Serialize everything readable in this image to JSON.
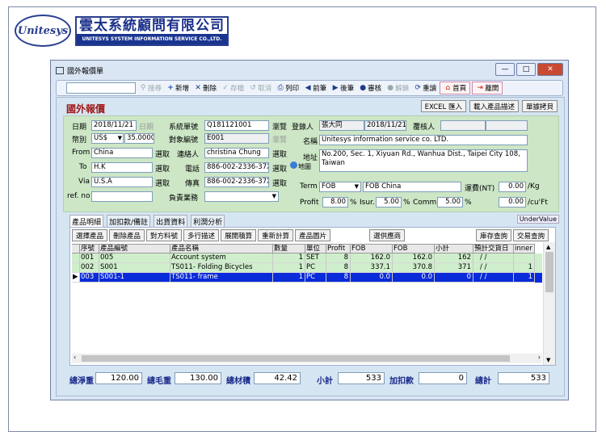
{
  "brand": {
    "logo_text": "Unitesys",
    "company_cn": "雲太系統顧問有限公司",
    "company_en": "UNITESYS SYSTEM INFORMATION SERVICE CO.,LTD."
  },
  "window": {
    "title": "國外報價單",
    "controls": {
      "minimize": "—",
      "maximize": "□",
      "close": "✕"
    }
  },
  "toolbar": {
    "search_value": "",
    "search_label": "搜尋",
    "buttons": [
      {
        "label": "新增",
        "icon": "+"
      },
      {
        "label": "刪除",
        "icon": "✕"
      },
      {
        "label": "存檔",
        "icon": "✓"
      },
      {
        "label": "取消",
        "icon": "↺"
      },
      {
        "label": "列印",
        "icon": "⎙"
      },
      {
        "label": "前筆",
        "icon": "◀"
      },
      {
        "label": "後筆",
        "icon": "▶"
      },
      {
        "label": "審核",
        "icon": "●"
      },
      {
        "label": "解鎖",
        "icon": "●"
      },
      {
        "label": "重讀",
        "icon": "⟳"
      },
      {
        "label": "首頁",
        "icon": "⌂"
      },
      {
        "label": "離開",
        "icon": "⇥"
      }
    ]
  },
  "form": {
    "title": "國外報價",
    "top_buttons": [
      "EXCEL 匯入",
      "載入產品描述",
      "單據拷貝"
    ],
    "date_label": "日期",
    "date_value": "2018/11/21",
    "date_btn": "日期",
    "currency_label": "幣別",
    "currency_value": "US$",
    "rate_value": "35.0000",
    "from_label": "From",
    "from_value": "China",
    "from_btn": "選取",
    "to_label": "To",
    "to_value": "H.K",
    "to_btn": "選取",
    "via_label": "Via",
    "via_value": "U.S.A",
    "via_btn": "選取",
    "refno_label": "ref. no",
    "refno_value": "",
    "sysno_label": "系統單號",
    "sysno_value": "Q181121001",
    "sysno_btn": "瀏覽",
    "objno_label": "對象編號",
    "objno_value": "E001",
    "objno_btn": "瀏覽",
    "contact_label": "連絡人",
    "contact_value": "christina Chung",
    "contact_btn": "選取",
    "phone_label": "電話",
    "phone_value": "886-002-2336-37XX",
    "phone_btn": "選取",
    "fax_label": "傳真",
    "fax_value": "886-002-2336-37XX",
    "fax_btn": "選取",
    "sales_label": "負責業務",
    "sales_value": "",
    "registrar_label": "登錄人",
    "registrar_value": "張大同",
    "registrar_date": "2018/11/21",
    "reviewer_label": "覆核人",
    "reviewer_value": "",
    "name_label": "名稱",
    "name_value": "Unitesys information service co. LTD.",
    "address_label": "地址",
    "address_value": "No.200, Sec. 1, Xiyuan Rd., Wanhua Dist., Taipei City 108, Taiwan",
    "map_label": "地圖",
    "term_label": "Term",
    "term_code": "FOB",
    "term_desc": "FOB China",
    "freight_label": "運費(NT)",
    "freight_value": "0.00",
    "freight_unit": "/Kg",
    "profit_label": "Profit",
    "profit_value": "8.00",
    "pct": "%",
    "isur_label": "Isur.",
    "isur_value": "5.00",
    "comm_label": "Comm.",
    "comm_value": "5.00",
    "cuft_value": "0.00",
    "cuft_unit": "/cu'Ft"
  },
  "tabs": [
    "產品明細",
    "加扣款/備註",
    "出貨資料",
    "利潤分析"
  ],
  "undervalue": "UnderValue",
  "detail_buttons_left": [
    "選擇產品",
    "刪除產品",
    "對方料號",
    "多行描述",
    "展開積算",
    "重新計算",
    "產品圖片"
  ],
  "detail_buttons_mid": "選供應商",
  "detail_buttons_right": [
    "庫存查詢",
    "交易查詢"
  ],
  "grid": {
    "headers": [
      "",
      "序號",
      "產品編號",
      "產品名稱",
      "數量",
      "單位",
      "Profit",
      "FOB",
      "FOB",
      "小計",
      "預計交貨日",
      "inner"
    ],
    "rows": [
      [
        "",
        "001",
        "005",
        "Account system",
        "1",
        "SET",
        "8",
        "162.0",
        "162.0",
        "162",
        "/ /",
        ""
      ],
      [
        "",
        "002",
        "S001",
        "TS011- Folding Bicycles",
        "1",
        "PC",
        "8",
        "337.1",
        "370.8",
        "371",
        "/ /",
        "1"
      ],
      [
        "▶",
        "003",
        "S001-1",
        "TS011- frame",
        "1",
        "PC",
        "8",
        "0.0",
        "0.0",
        "0",
        "/ /",
        "1"
      ]
    ]
  },
  "totals": {
    "net_weight_label": "總淨重",
    "net_weight": "120.00",
    "gross_weight_label": "總毛重",
    "gross_weight": "130.00",
    "volume_label": "總材積",
    "volume": "42.42",
    "subtotal_label": "小計",
    "subtotal": "533",
    "adjust_label": "加扣款",
    "adjust": "0",
    "total_label": "總計",
    "total": "533"
  }
}
